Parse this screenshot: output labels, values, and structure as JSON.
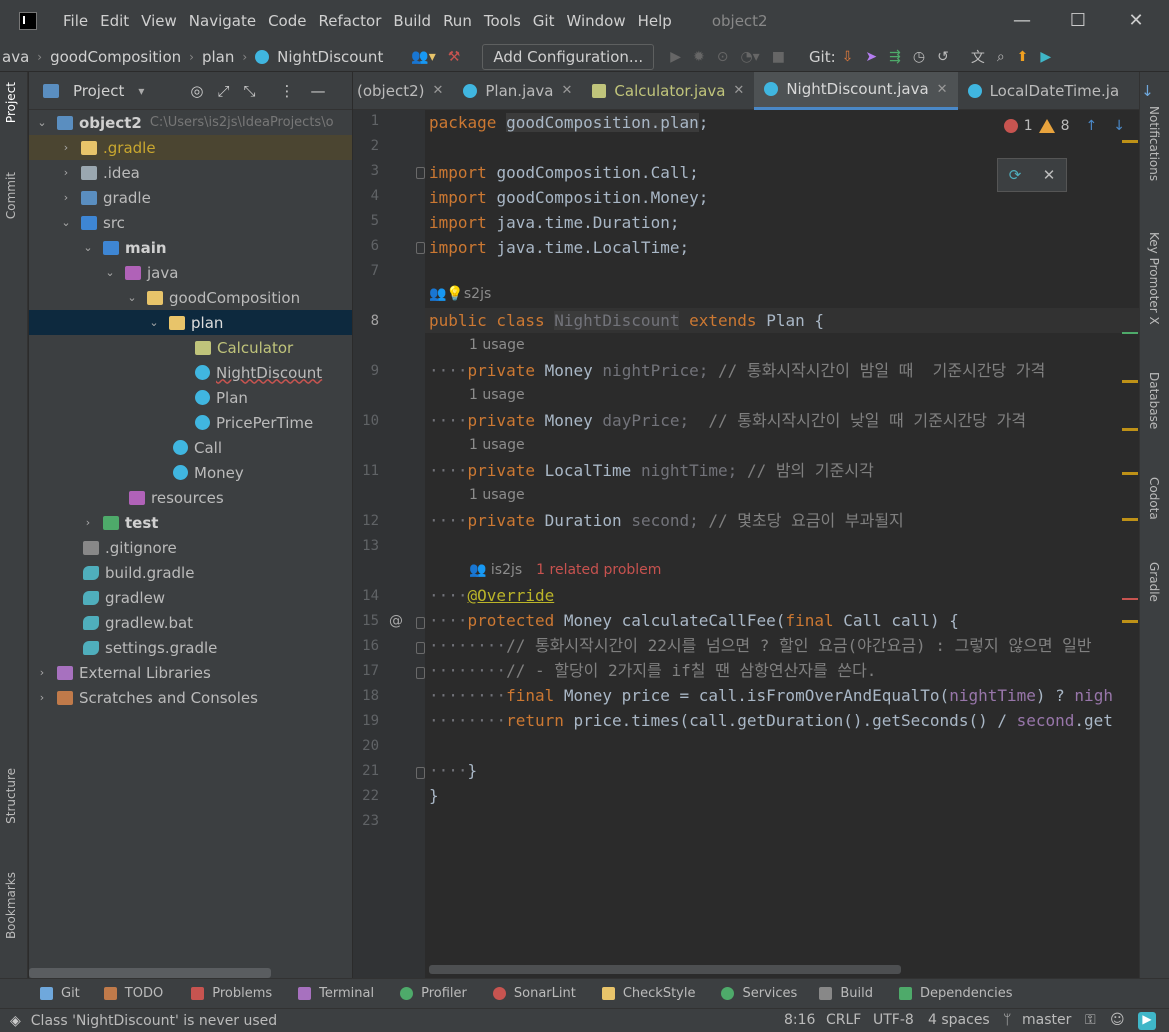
{
  "window": {
    "title": "object2"
  },
  "menu": [
    "File",
    "Edit",
    "View",
    "Navigate",
    "Code",
    "Refactor",
    "Build",
    "Run",
    "Tools",
    "Git",
    "Window",
    "Help"
  ],
  "breadcrumb": [
    "ava",
    "goodComposition",
    "plan",
    "NightDiscount"
  ],
  "toolbar": {
    "add_config": "Add Configuration...",
    "git_label": "Git:"
  },
  "project_panel": {
    "title": "Project",
    "root": {
      "name": "object2",
      "path": "C:\\Users\\is2js\\IdeaProjects\\o"
    },
    "items": [
      {
        "label": ".gradle"
      },
      {
        "label": ".idea"
      },
      {
        "label": "gradle"
      },
      {
        "label": "src"
      },
      {
        "label": "main"
      },
      {
        "label": "java"
      },
      {
        "label": "goodComposition"
      },
      {
        "label": "plan"
      },
      {
        "label": "Calculator"
      },
      {
        "label": "NightDiscount"
      },
      {
        "label": "Plan"
      },
      {
        "label": "PricePerTime"
      },
      {
        "label": "Call"
      },
      {
        "label": "Money"
      },
      {
        "label": "resources"
      },
      {
        "label": "test"
      },
      {
        "label": ".gitignore"
      },
      {
        "label": "build.gradle"
      },
      {
        "label": "gradlew"
      },
      {
        "label": "gradlew.bat"
      },
      {
        "label": "settings.gradle"
      },
      {
        "label": "External Libraries"
      },
      {
        "label": "Scratches and Consoles"
      }
    ]
  },
  "tabs": [
    {
      "label": "(object2)"
    },
    {
      "label": "Plan.java"
    },
    {
      "label": "Calculator.java"
    },
    {
      "label": "NightDiscount.java"
    },
    {
      "label": "LocalDateTime.ja"
    }
  ],
  "inspections": {
    "errors": "1",
    "warnings": "8"
  },
  "editor": {
    "line_numbers": [
      "1",
      "2",
      "3",
      "4",
      "5",
      "6",
      "7",
      "8",
      "9",
      "10",
      "11",
      "12",
      "13",
      "14",
      "15",
      "16",
      "17",
      "18",
      "19",
      "20",
      "21",
      "22",
      "23"
    ],
    "hints": {
      "author_top": "s2js",
      "usage": "1 usage",
      "author": "is2js",
      "related_problem": "1 related problem"
    },
    "code": {
      "l1_kw": "package",
      "l1_rest": "goodComposition.plan",
      "l3": "goodComposition.Call;",
      "l4": "goodComposition.Money;",
      "l5": "java.time.Duration;",
      "l6": "java.time.LocalTime;",
      "import_kw": "import",
      "l8_name": "NightDiscount",
      "l8_super": "Plan {",
      "l9_type": "Money",
      "l9_field": "nightPrice",
      "l9_cmt": "// 통화시작시간이 밤일 때  기준시간당 가격",
      "l10_type": "Money",
      "l10_field": "dayPrice",
      "l10_cmt": "// 통화시작시간이 낮일 때 기준시간당 가격",
      "l11_type": "LocalTime",
      "l11_field": "nightTime",
      "l11_cmt": "// 밤의 기준시각",
      "l12_type": "Duration",
      "l12_field": "second",
      "l12_cmt": "// 몇초당 요금이 부과될지",
      "l14": "@Override",
      "l15_mid": "Money calculateCallFee(",
      "l15_param": "Call call) {",
      "l16": "// 통화시작시간이 22시를 넘으면 ? 할인 요금(야간요금) : 그렇지 않으면 일반",
      "l17": "// - 할당이 2가지를 if칠 땐 삼항연산자를 쓴다.",
      "l18_a": "Money price = call.isFromOverAndEqualTo(",
      "l18_f": "nightTime",
      "l18_b": ") ? ",
      "l18_c": "nigh",
      "l19_a": "price.times(call.getDuration().getSeconds() / ",
      "l19_f": "second",
      "l19_b": ".get"
    }
  },
  "bottom_tools": [
    "Git",
    "TODO",
    "Problems",
    "Terminal",
    "Profiler",
    "SonarLint",
    "CheckStyle",
    "Services",
    "Build",
    "Dependencies"
  ],
  "status": {
    "message": "Class 'NightDiscount' is never used",
    "position": "8:16",
    "line_sep": "CRLF",
    "encoding": "UTF-8",
    "indent": "4 spaces",
    "branch": "master"
  },
  "side_tabs": {
    "left": [
      "Project",
      "Commit",
      "Structure",
      "Bookmarks"
    ],
    "right": [
      "Notifications",
      "Key Promoter X",
      "Database",
      "Codota",
      "Gradle"
    ]
  }
}
